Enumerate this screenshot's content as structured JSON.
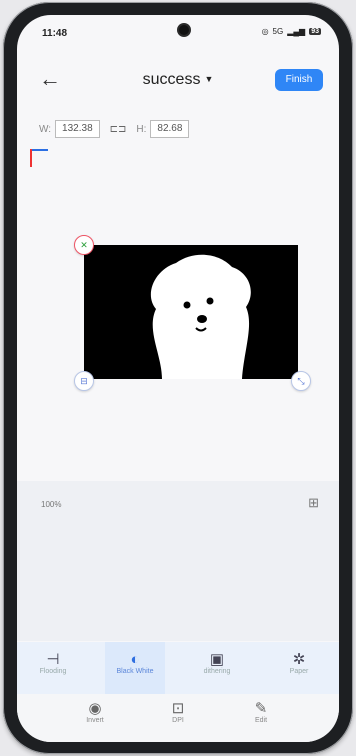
{
  "status": {
    "time": "11:48",
    "signal": "5G",
    "battery": "93"
  },
  "header": {
    "back_icon": "arrow-left-icon",
    "title": "success",
    "finish_label": "Finish"
  },
  "dimensions": {
    "w_label": "W:",
    "w_value": "132.38",
    "h_label": "H:",
    "h_value": "82.68"
  },
  "canvas": {
    "zoom": "100%"
  },
  "tools": [
    {
      "label": "Flooding",
      "icon": "flooding-icon"
    },
    {
      "label": "Black White",
      "icon": "contrast-icon"
    },
    {
      "label": "dithering",
      "icon": "dithering-icon"
    },
    {
      "label": "Paper",
      "icon": "paper-icon"
    }
  ],
  "tools2": [
    {
      "label": "Invert",
      "icon": "invert-icon"
    },
    {
      "label": "DPI",
      "icon": "dpi-icon"
    },
    {
      "label": "Edit",
      "icon": "edit-icon"
    }
  ],
  "colors": {
    "accent": "#2f86f6",
    "active_tool_bg": "#dce9fb"
  }
}
